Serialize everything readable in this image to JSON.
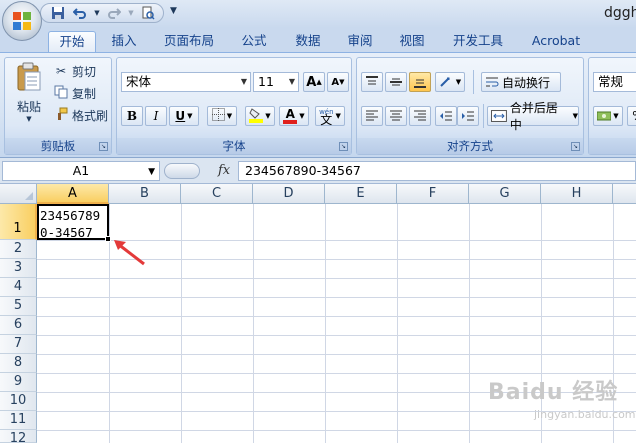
{
  "title_fragment": "dggh",
  "tabs": [
    "开始",
    "插入",
    "页面布局",
    "公式",
    "数据",
    "审阅",
    "视图",
    "开发工具",
    "Acrobat"
  ],
  "clipboard": {
    "paste": "粘贴",
    "cut": "剪切",
    "copy": "复制",
    "format_painter": "格式刷",
    "label": "剪贴板"
  },
  "font": {
    "name": "宋体",
    "size": "11",
    "grow": "A",
    "shrink": "A",
    "bold": "B",
    "italic": "I",
    "underline": "U",
    "font_color_glyph": "A",
    "phonetic": "文",
    "phonetic_top": "wén",
    "label": "字体"
  },
  "alignment": {
    "wrap_text": "自动换行",
    "merge_center": "合并后居中",
    "label": "对齐方式"
  },
  "number": {
    "format": "常规",
    "percent": "%"
  },
  "formula_bar": {
    "name_box": "A1",
    "fx": "fx",
    "content": "234567890-34567"
  },
  "sheet": {
    "columns": [
      "A",
      "B",
      "C",
      "D",
      "E",
      "F",
      "G",
      "H"
    ],
    "rows": [
      "1",
      "2",
      "3",
      "4",
      "5",
      "6",
      "7",
      "8",
      "9",
      "10",
      "11",
      "12"
    ],
    "a1_line1": "23456789",
    "a1_line2": "0-34567"
  },
  "watermark": {
    "brand": "Baidu 经验",
    "url": "jingyan.baidu.com"
  },
  "colors": {
    "ribbon_bg": "#d6e3f3",
    "selection_header": "#f9cf62",
    "arrow": "#e33a3a"
  }
}
